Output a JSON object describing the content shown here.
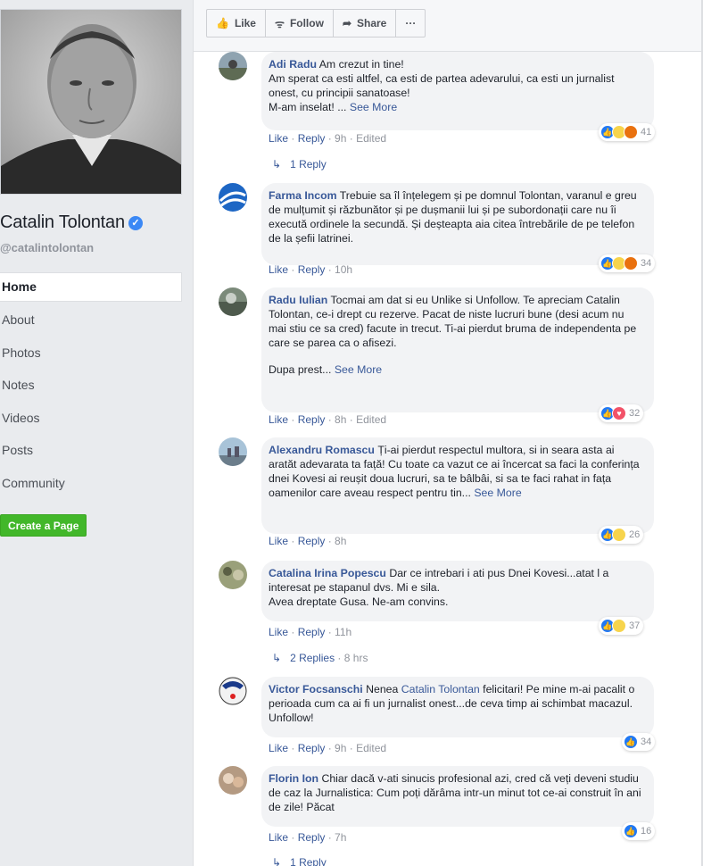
{
  "page": {
    "name": "Catalin Tolontan",
    "handle": "@catalintolontan"
  },
  "nav": [
    {
      "label": "Home",
      "active": true
    },
    {
      "label": "About"
    },
    {
      "label": "Photos"
    },
    {
      "label": "Notes"
    },
    {
      "label": "Videos"
    },
    {
      "label": "Posts"
    },
    {
      "label": "Community"
    }
  ],
  "create_page": "Create a Page",
  "actions": {
    "like": "Like",
    "follow": "Follow",
    "share": "Share",
    "more": "···"
  },
  "meta_labels": {
    "like": "Like",
    "reply": "Reply",
    "sep": " · ",
    "edited": "Edited",
    "see_more": "See More"
  },
  "comments": [
    {
      "author": "Adi Radu",
      "text": "Am crezut in tine!\nAm sperat ca esti altfel, ca esti de partea adevarului, ca esti un jurnalist onest, cu principii sanatoase!\nM-am inselat! ... ",
      "see_more": "See More",
      "time": "9h",
      "edited": true,
      "reactions": [
        "like",
        "sad",
        "angry"
      ],
      "count": "41",
      "replies": "1 Reply"
    },
    {
      "author": "Farma Incom",
      "text": "Trebuie sa îl înțelegem și pe domnul Tolontan, varanul e greu de mulțumit și răzbunător și pe dușmanii lui și pe subordonații care nu îi execută ordinele la secundă. Și deșteapta aia citea întrebările de pe telefon de la șefii latrinei.",
      "time": "10h",
      "edited": false,
      "reactions": [
        "like",
        "haha",
        "angry"
      ],
      "count": "34"
    },
    {
      "author": "Radu Iulian",
      "text": "Tocmai am dat si eu Unlike si Unfollow. Te apreciam Catalin Tolontan, ce-i drept cu rezerve. Pacat de niste lucruri bune (desi acum nu mai stiu ce sa cred) facute in trecut. Ti-ai pierdut bruma de independenta pe care se parea ca o afisezi.",
      "text2": "Dupa prest... ",
      "see_more": "See More",
      "time": "8h",
      "edited": true,
      "reactions": [
        "like",
        "love"
      ],
      "count": "32"
    },
    {
      "author": "Alexandru Romascu",
      "text": "Ți-ai pierdut respectul multora, si in seara asta ai aratăt adevarata ta față! Cu toate ca vazut ce ai încercat sa faci la conferința dnei Kovesi ai reușit doua lucruri, sa te bâlbâi, si sa te faci rahat in fața oamenilor care aveau respect pentru tin... ",
      "see_more": "See More",
      "time": "8h",
      "edited": false,
      "reactions": [
        "like",
        "haha"
      ],
      "count": "26"
    },
    {
      "author": "Catalina Irina Popescu",
      "text": "Dar ce intrebari i ati pus Dnei Kovesi...atat l a interesat pe stapanul dvs. Mi e sila.\nAvea dreptate Gusa. Ne-am convins.",
      "time": "11h",
      "edited": false,
      "reactions": [
        "like",
        "sad"
      ],
      "count": "37",
      "replies": "2 Replies",
      "replies_time": "8 hrs"
    },
    {
      "author": "Victor Focsanschi",
      "text_pre": "Nenea ",
      "mention": "Catalin Tolontan",
      "text": " felicitari! Pe mine m-ai pacalit o perioada cum ca ai fi un jurnalist onest...de ceva timp ai schimbat macazul. Unfollow!",
      "time": "9h",
      "edited": true,
      "reactions": [
        "like"
      ],
      "count": "34"
    },
    {
      "author": "Florin Ion",
      "text": "Chiar dacă v-ati sinucis profesional azi, cred că veți deveni studiu de caz la Jurnalistica: Cum poți dărâma intr-un minut tot ce-ai construit în ani de zile! Păcat",
      "time": "7h",
      "edited": false,
      "reactions": [
        "like"
      ],
      "count": "16",
      "replies": "1 Reply"
    }
  ],
  "colors": {
    "link": "#385898",
    "create_button": "#42b72a",
    "like_blue": "#2078f4"
  }
}
